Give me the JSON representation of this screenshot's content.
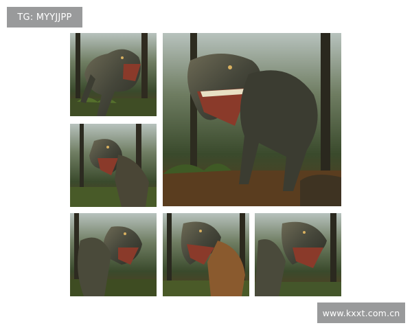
{
  "watermark_top_left": "TG: MYYJJPP",
  "watermark_bottom_right": "www.kxxt.com.cn",
  "colors": {
    "badge_bg": "#999a9b",
    "forest_dark": "#26321d",
    "forest_light": "#8a9a86",
    "dino_body": "#4a4a3c",
    "mouth": "#8a3a2a"
  }
}
